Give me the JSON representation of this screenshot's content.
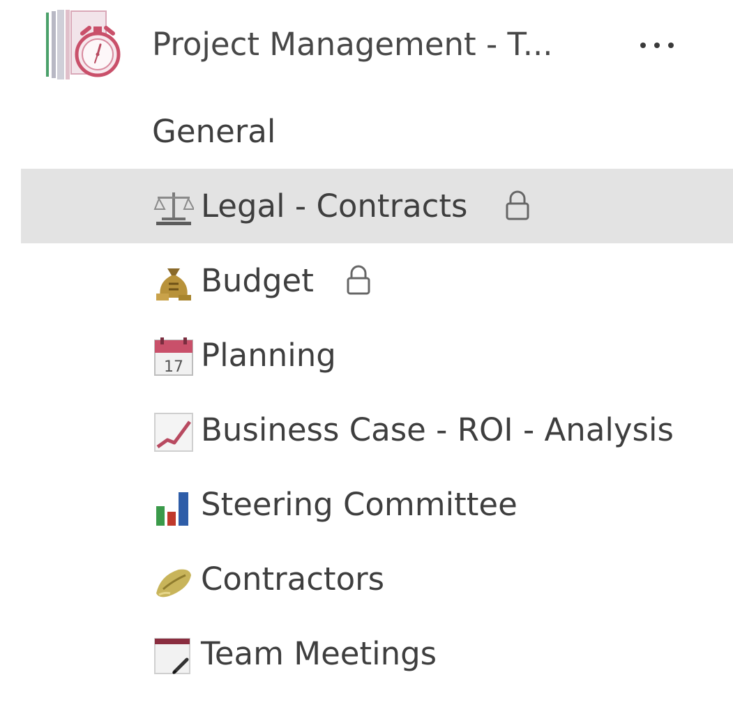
{
  "team": {
    "name": "Project Management - T...",
    "icon": "alarm-clock-book-icon",
    "more_icon": "more-options-icon"
  },
  "channels": [
    {
      "label": "General",
      "icon": null,
      "locked": false,
      "selected": false
    },
    {
      "label": "Legal - Contracts",
      "icon": "scales-icon",
      "locked": true,
      "selected": true
    },
    {
      "label": "Budget",
      "icon": "money-bag-icon",
      "locked": true,
      "selected": false
    },
    {
      "label": "Planning",
      "icon": "calendar-icon",
      "locked": false,
      "selected": false
    },
    {
      "label": "Business Case - ROI - Analysis",
      "icon": "trend-chart-icon",
      "locked": false,
      "selected": false
    },
    {
      "label": "Steering Committee",
      "icon": "bar-chart-icon",
      "locked": false,
      "selected": false
    },
    {
      "label": "Contractors",
      "icon": "handshake-icon",
      "locked": false,
      "selected": false
    },
    {
      "label": "Team Meetings",
      "icon": "notepad-icon",
      "locked": false,
      "selected": false
    }
  ],
  "calendar_day": "17",
  "colors": {
    "selected_background": "#e3e3e3",
    "text": "#3e3e3e",
    "accent_pink": "#c9506a"
  }
}
